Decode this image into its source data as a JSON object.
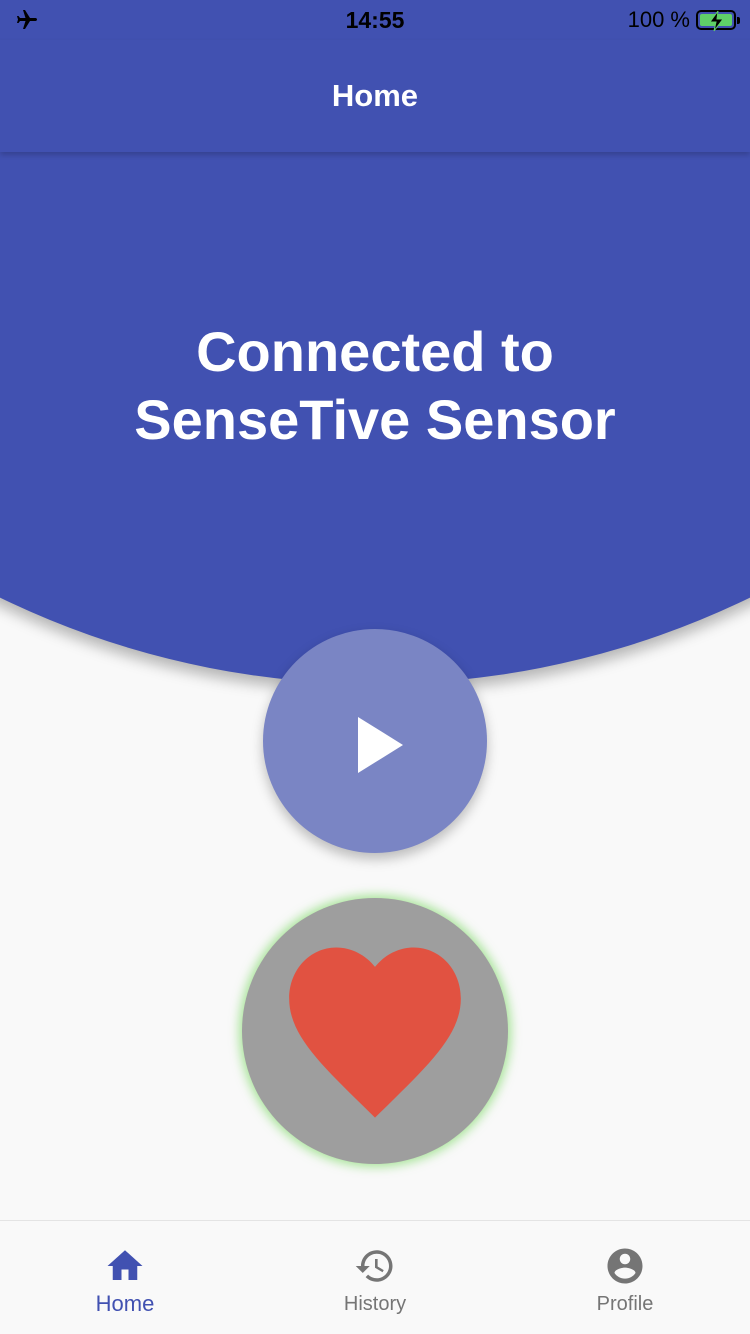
{
  "status_bar": {
    "time": "14:55",
    "battery_text": "100 %",
    "airplane_icon": "airplane-icon",
    "battery_icon": "battery-charging-icon"
  },
  "app_bar": {
    "title": "Home"
  },
  "hero": {
    "line1": "Connected to",
    "line2": "SenseTive Sensor"
  },
  "play_button": {
    "icon": "play-icon"
  },
  "heart_indicator": {
    "icon": "heart-icon"
  },
  "bottom_nav": {
    "items": [
      {
        "label": "Home",
        "icon": "home-icon",
        "active": true
      },
      {
        "label": "History",
        "icon": "history-icon",
        "active": false
      },
      {
        "label": "Profile",
        "icon": "account-circle-icon",
        "active": false
      }
    ]
  },
  "colors": {
    "primary": "#4151b1",
    "play_button": "#7a85c4",
    "heart": "#e15241",
    "heart_circle": "#9e9e9e",
    "glow": "#8cdc78",
    "inactive": "#757575",
    "background": "#f9f9f9"
  }
}
